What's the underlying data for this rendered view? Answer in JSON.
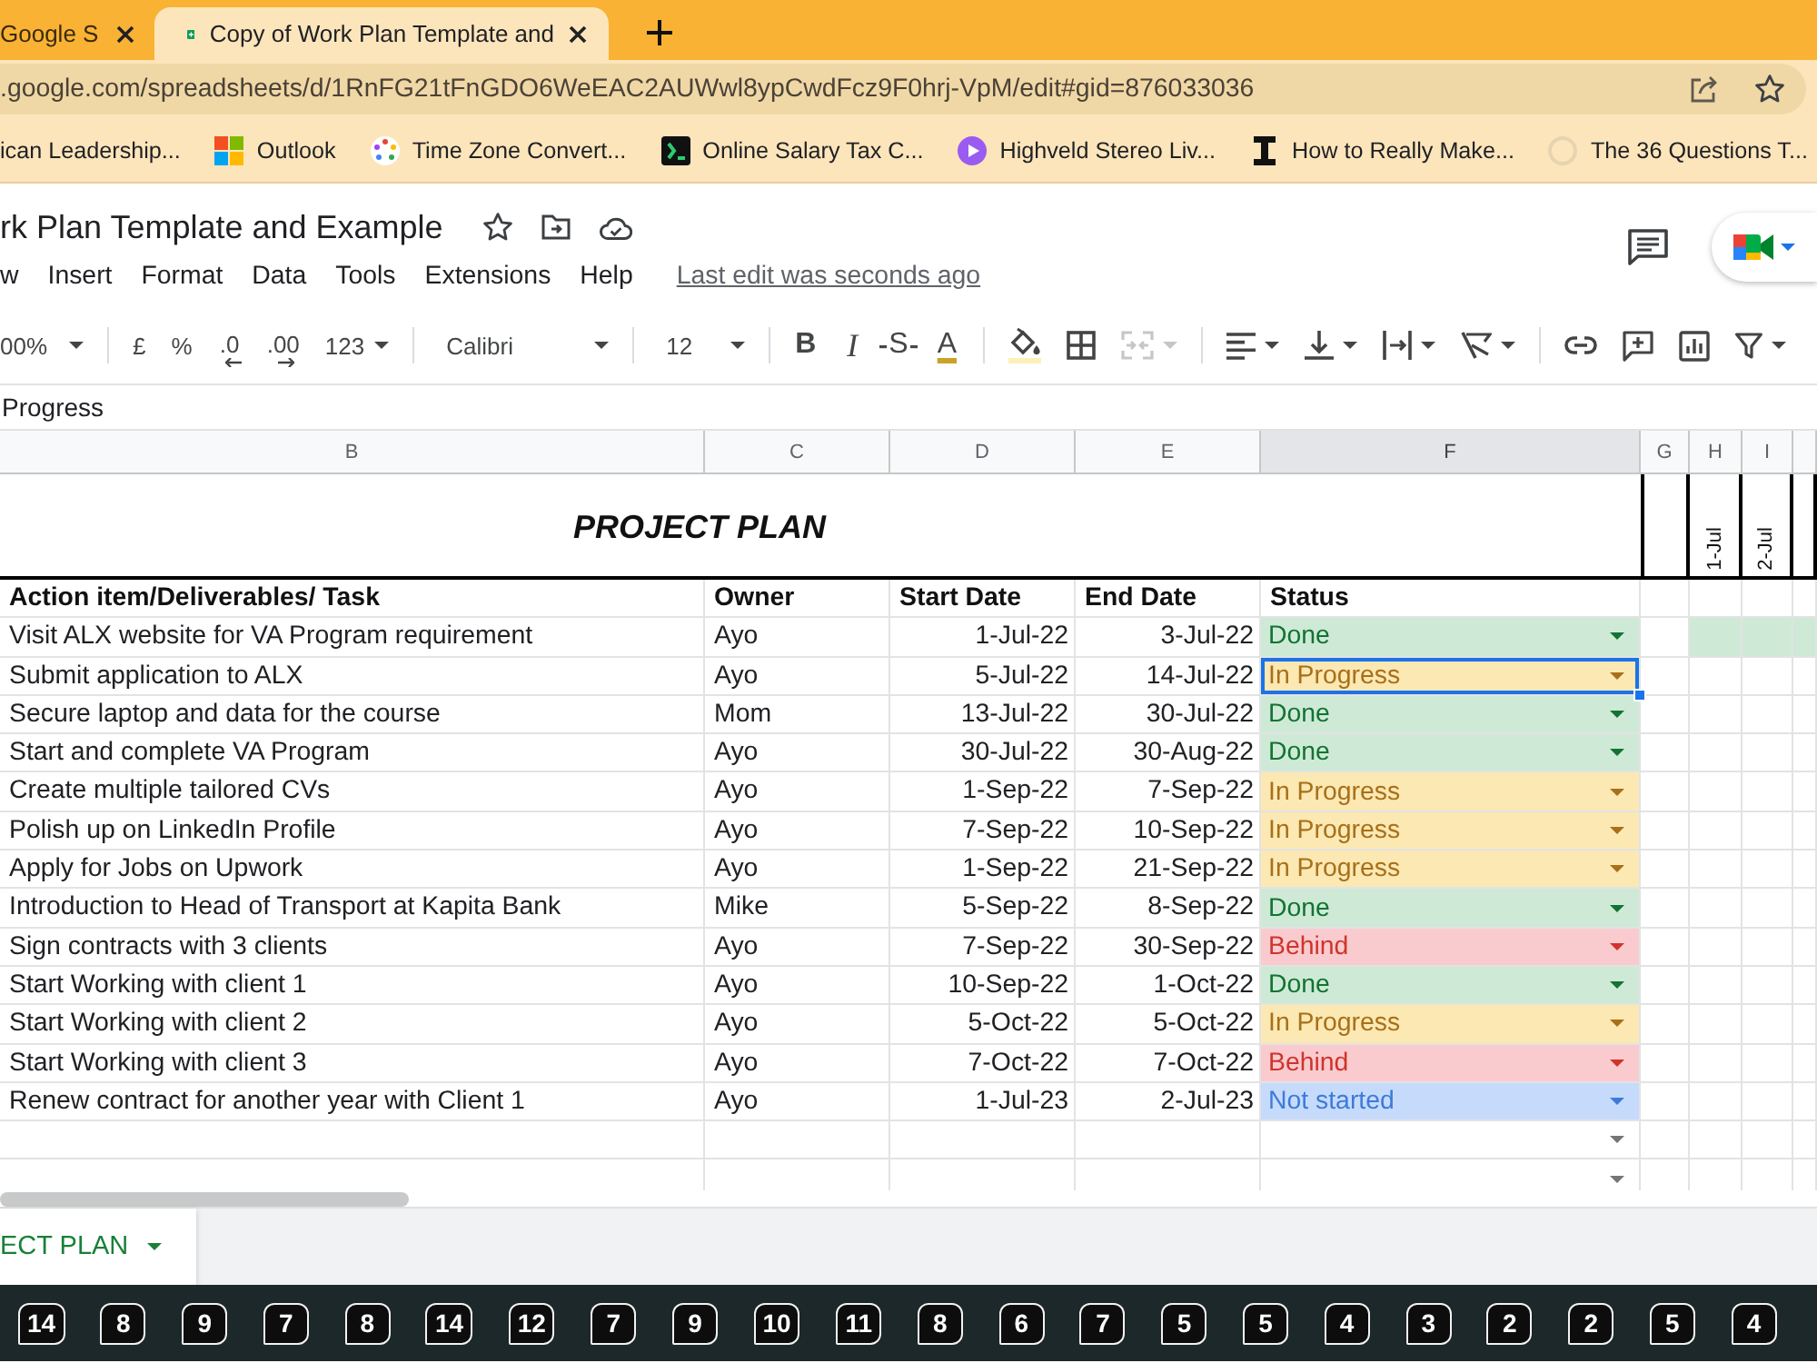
{
  "browser": {
    "tabs": [
      {
        "title": "Google S",
        "selected": false
      },
      {
        "title": "Copy of Work Plan Template and",
        "selected": true
      }
    ],
    "address": ".google.com/spreadsheets/d/1RnFG21tFnGDO6WeEAC2AUWwl8ypCwdFcz9F0hrj-VpM/edit#gid=876033036",
    "bookmarks": [
      {
        "label": "ican Leadership...",
        "kind": "none"
      },
      {
        "label": "Outlook",
        "kind": "tiles"
      },
      {
        "label": "Time Zone Convert...",
        "kind": "dots"
      },
      {
        "label": "Online Salary Tax C...",
        "kind": "tile"
      },
      {
        "label": "Highveld Stereo Liv...",
        "kind": "disc"
      },
      {
        "label": "How to Really Make...",
        "kind": "beam"
      },
      {
        "label": "The 36 Questions T...",
        "kind": "ring"
      }
    ]
  },
  "document": {
    "title": "rk Plan Template and Example",
    "menu": [
      "w",
      "Insert",
      "Format",
      "Data",
      "Tools",
      "Extensions",
      "Help"
    ],
    "last_edit": "Last edit was seconds ago"
  },
  "toolbar": {
    "zoom": "00%",
    "currency": "£",
    "percent": "%",
    "decrease_decimals": ".0",
    "increase_decimals": ".00",
    "number_format": "123",
    "font": "Calibri",
    "font_size": "12",
    "bold": "B",
    "italic": "I",
    "strikethrough": "S",
    "text_color": "A",
    "merge": {
      "disabled": true
    }
  },
  "formula_bar": {
    "value": "Progress"
  },
  "sheet": {
    "columns": [
      {
        "label": "B",
        "selected": false
      },
      {
        "label": "C",
        "selected": false
      },
      {
        "label": "D",
        "selected": false
      },
      {
        "label": "E",
        "selected": false
      },
      {
        "label": "F",
        "selected": true
      },
      {
        "label": "G",
        "selected": false
      },
      {
        "label": "H",
        "selected": false
      },
      {
        "label": "I",
        "selected": false
      }
    ],
    "title": "PROJECT PLAN",
    "timeline_dates": [
      "1-Jul",
      "2-Jul"
    ],
    "headers": [
      "Action item/Deliverables/ Task",
      "Owner",
      "Start Date",
      "End Date",
      "Status"
    ],
    "rows": [
      {
        "task": "Visit ALX website for VA Program requirement",
        "owner": "Ayo",
        "start": "1-Jul-22",
        "end": "3-Jul-22",
        "status": {
          "label": "Done",
          "color": "#ceead6",
          "selected": false
        },
        "timeline": [
          true,
          true,
          true
        ]
      },
      {
        "task": "Submit application to ALX",
        "owner": "Ayo",
        "start": "5-Jul-22",
        "end": "14-Jul-22",
        "status": {
          "label": "In Progress",
          "color": "#fce8b2",
          "selected": true
        },
        "timeline": [
          false,
          false,
          false
        ]
      },
      {
        "task": "Secure laptop and data for the course",
        "owner": "Mom",
        "start": "13-Jul-22",
        "end": "30-Jul-22",
        "status": {
          "label": "Done",
          "color": "#ceead6",
          "selected": false
        },
        "timeline": [
          false,
          false,
          false
        ]
      },
      {
        "task": "Start and complete VA Program",
        "owner": "Ayo",
        "start": "30-Jul-22",
        "end": "30-Aug-22",
        "status": {
          "label": "Done",
          "color": "#ceead6",
          "selected": false
        },
        "timeline": [
          false,
          false,
          false
        ]
      },
      {
        "task": "Create multiple tailored CVs",
        "owner": "Ayo",
        "start": "1-Sep-22",
        "end": "7-Sep-22",
        "status": {
          "label": "In Progress",
          "color": "#fce8b2",
          "selected": false
        },
        "timeline": [
          false,
          false,
          false
        ]
      },
      {
        "task": "Polish up on LinkedIn Profile",
        "owner": "Ayo",
        "start": "7-Sep-22",
        "end": "10-Sep-22",
        "status": {
          "label": "In Progress",
          "color": "#fce8b2",
          "selected": false
        },
        "timeline": [
          false,
          false,
          false
        ]
      },
      {
        "task": "Apply for Jobs on Upwork",
        "owner": "Ayo",
        "start": "1-Sep-22",
        "end": "21-Sep-22",
        "status": {
          "label": "In Progress",
          "color": "#fce8b2",
          "selected": false
        },
        "timeline": [
          false,
          false,
          false
        ]
      },
      {
        "task": "Introduction to Head of Transport at Kapita Bank",
        "owner": "Mike",
        "start": "5-Sep-22",
        "end": "8-Sep-22",
        "status": {
          "label": "Done",
          "color": "#ceead6",
          "selected": false
        },
        "timeline": [
          false,
          false,
          false
        ]
      },
      {
        "task": "Sign contracts with 3 clients",
        "owner": "Ayo",
        "start": "7-Sep-22",
        "end": "30-Sep-22",
        "status": {
          "label": "Behind",
          "color": "#f9cbcf",
          "selected": false
        },
        "timeline": [
          false,
          false,
          false
        ]
      },
      {
        "task": "Start Working with client 1",
        "owner": "Ayo",
        "start": "10-Sep-22",
        "end": "1-Oct-22",
        "status": {
          "label": "Done",
          "color": "#ceead6",
          "selected": false
        },
        "timeline": [
          false,
          false,
          false
        ]
      },
      {
        "task": "Start Working with client 2",
        "owner": "Ayo",
        "start": "5-Oct-22",
        "end": "5-Oct-22",
        "status": {
          "label": "In Progress",
          "color": "#fce8b2",
          "selected": false
        },
        "timeline": [
          false,
          false,
          false
        ]
      },
      {
        "task": "Start Working with client 3",
        "owner": "Ayo",
        "start": "7-Oct-22",
        "end": "7-Oct-22",
        "status": {
          "label": "Behind",
          "color": "#f9cbcf",
          "selected": false
        },
        "timeline": [
          false,
          false,
          false
        ]
      },
      {
        "task": "Renew contract for another year with Client 1",
        "owner": "Ayo",
        "start": "1-Jul-23",
        "end": "2-Jul-23",
        "status": {
          "label": "Not started",
          "color": "#c6dbfc",
          "selected": false
        },
        "timeline": [
          false,
          false,
          false
        ]
      }
    ],
    "blank_rows": [
      {
        "dropdown": true
      },
      {
        "dropdown": true
      }
    ]
  },
  "sheet_tabs": [
    {
      "label": "ECT PLAN",
      "selected": true
    }
  ],
  "taskbar": [
    {
      "count": "14"
    },
    {
      "count": "8"
    },
    {
      "count": "9"
    },
    {
      "count": "7"
    },
    {
      "count": "8"
    },
    {
      "count": "14"
    },
    {
      "count": "12"
    },
    {
      "count": "7"
    },
    {
      "count": "9"
    },
    {
      "count": "10"
    },
    {
      "count": "11"
    },
    {
      "count": "8"
    },
    {
      "count": "6"
    },
    {
      "count": "7"
    },
    {
      "count": "5"
    },
    {
      "count": "5"
    },
    {
      "count": "4"
    },
    {
      "count": "3"
    },
    {
      "count": "2"
    },
    {
      "count": "2"
    },
    {
      "count": "5"
    },
    {
      "count": "4"
    }
  ]
}
